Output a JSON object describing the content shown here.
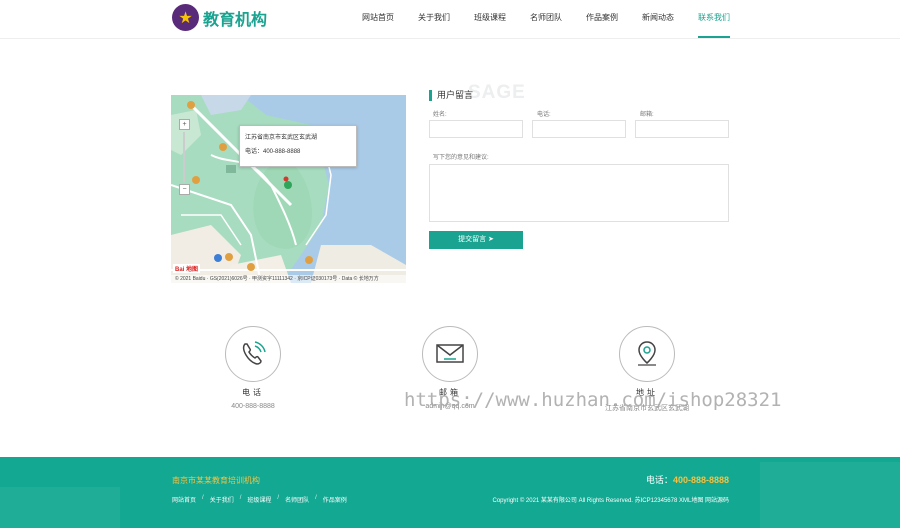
{
  "header": {
    "logo_text": "教育机构",
    "nav": [
      "网站首页",
      "关于我们",
      "班级课程",
      "名师团队",
      "作品案例",
      "新闻动态",
      "联系我们"
    ],
    "active_index": 6
  },
  "map": {
    "popup_address": "江苏省南京市玄武区玄武湖",
    "popup_tel": "电话：400-888-8888",
    "footer_text": "© 2021 Baidu · GS(2021)6026号 · 甲测资字11111342 · 京ICP证030173号 · Data © 长地万方",
    "logo": "Bai 地图",
    "zoom_in": "+",
    "zoom_out": "−"
  },
  "form": {
    "watermark": "SAGE",
    "title": "用户留言",
    "name_label": "姓名:",
    "phone_label": "电话:",
    "email_label": "邮箱:",
    "message_label": "写下您的意见和建议:",
    "submit_label": "提交留言 ➤"
  },
  "contacts": [
    {
      "label": "电话",
      "value": "400-888-8888",
      "icon": "phone-icon"
    },
    {
      "label": "邮箱",
      "value": "admin@qq.com",
      "icon": "mail-icon"
    },
    {
      "label": "地址",
      "value": "江苏省南京市玄武区玄武湖",
      "icon": "location-icon"
    }
  ],
  "overlay_watermark": "https://www.huzhan.com/ishop28321",
  "footer": {
    "company": "南京市某某教育培训机构",
    "phone_label": "电话：",
    "phone": "400-888-8888",
    "links": [
      "网站首页",
      "关于我们",
      "班级课程",
      "名师团队",
      "作品案例"
    ],
    "link_sep": "/",
    "copyright": "Copyright © 2021 某某有限公司 All Rights Reserved. 苏ICP12345678 XML地图 网站源码"
  },
  "colors": {
    "accent": "#1aa390",
    "footer_bg": "#12a892",
    "highlight": "#f5c242"
  }
}
